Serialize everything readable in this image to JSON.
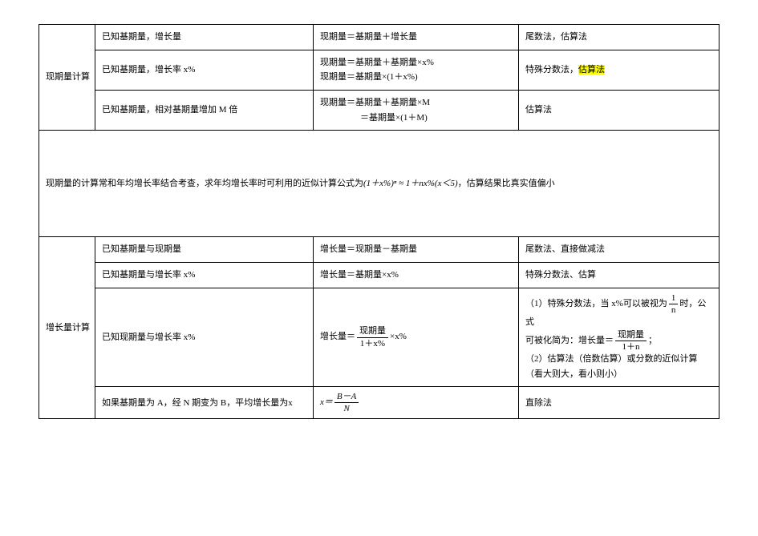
{
  "table1": {
    "label": "现期量计算",
    "rows": [
      {
        "given": "已知基期量，增长量",
        "formula1": "现期量＝基期量＋增长量",
        "method": "尾数法，估算法"
      },
      {
        "given": "已知基期量，增长率 x%",
        "formula1": "现期量＝基期量＋基期量×x%",
        "formula2": "现期量＝基期量×(1＋x%)",
        "method_prefix": "特殊分数法，",
        "method_hl": "估算法"
      },
      {
        "given": "已知基期量，相对基期量增加 M 倍",
        "formula1": "现期量＝基期量＋基期量×M",
        "formula2_indent": "＝基期量×(1＋M)",
        "method": "估算法"
      }
    ]
  },
  "note": {
    "prefix": "现期量的计算常和年均增长率结合考查，求年均增长率时可利用的近似计算公式为",
    "math": "(1＋x%)ⁿ ≈ 1＋nx%(x＜5)",
    "suffix": "，估算结果比真实值偏小"
  },
  "table2": {
    "label": "增长量计算",
    "rows": [
      {
        "given": "已知基期量与现期量",
        "formula_text": "增长量＝现期量－基期量",
        "method": "尾数法、直接做减法"
      },
      {
        "given": "已知基期量与增长率 x%",
        "formula_text": "增长量＝基期量×x%",
        "method": "特殊分数法、估算"
      },
      {
        "given": "已知现期量与增长率 x%",
        "formula_label": "增长量＝",
        "frac_num": "现期量",
        "frac_den": "1＋x%",
        "formula_tail": "×x%",
        "method_l1a": "（1）特殊分数法，当 x%可以被视为",
        "method_l1_num": "1",
        "method_l1_den": "n",
        "method_l1b": "时，公式",
        "method_l2a": "可被化简为：增长量＝",
        "method_l2_num": "现期量",
        "method_l2_den": "1＋n",
        "method_l2b": "；",
        "method_l3": "（2）估算法（倍数估算）或分数的近似计算（看大则大，看小则小）"
      },
      {
        "given": "如果基期量为 A，经 N 期变为 B，平均增长量为x",
        "formula_lhs": "x＝",
        "frac_num": "B－A",
        "frac_den": "N",
        "method": "直除法"
      }
    ]
  }
}
